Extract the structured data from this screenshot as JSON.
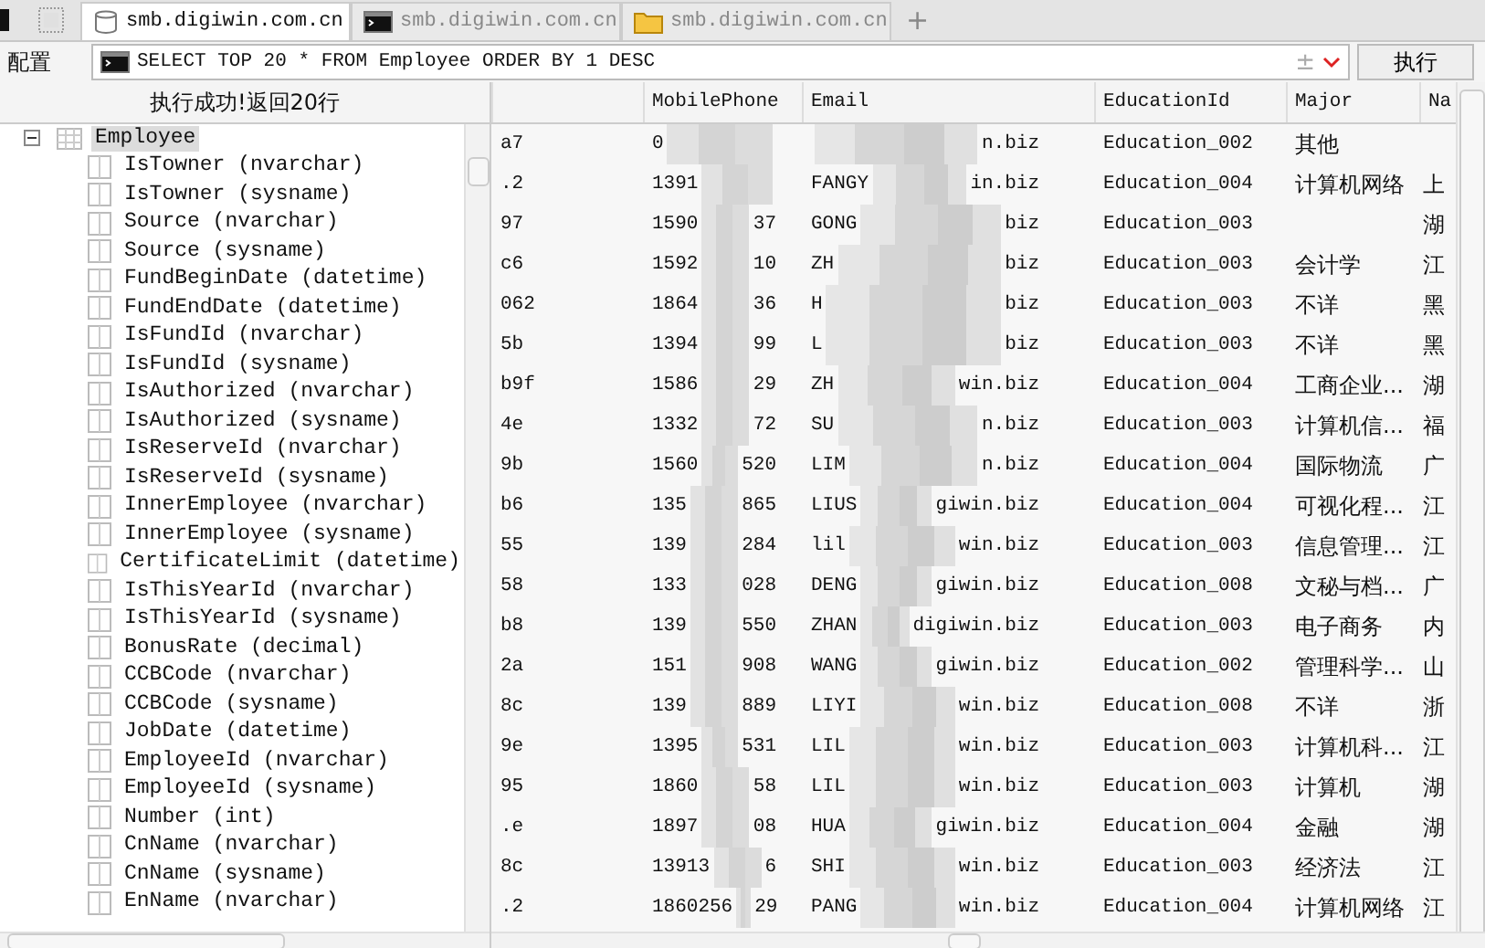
{
  "tabs": [
    {
      "label": "smb.digiwin.com.cn",
      "kind": "database",
      "selected": true
    },
    {
      "label": "smb.digiwin.com.cn",
      "kind": "console",
      "selected": false
    },
    {
      "label": "smb.digiwin.com.cn",
      "kind": "folder",
      "selected": false
    }
  ],
  "new_tab": "+",
  "toolbar": {
    "label": "配置",
    "query": "SELECT TOP 20 * FROM Employee ORDER BY 1 DESC",
    "plus_minus": "±",
    "run_button": "执行"
  },
  "status": "执行成功!返回20行",
  "tree": {
    "label": "Employee",
    "expanded": true,
    "selected": true,
    "children": [
      {
        "label": "IsTowner (nvarchar)"
      },
      {
        "label": "IsTowner (sysname)"
      },
      {
        "label": "Source (nvarchar)"
      },
      {
        "label": "Source (sysname)"
      },
      {
        "label": "FundBeginDate (datetime)"
      },
      {
        "label": "FundEndDate (datetime)"
      },
      {
        "label": "IsFundId (nvarchar)"
      },
      {
        "label": "IsFundId (sysname)"
      },
      {
        "label": "IsAuthorized (nvarchar)"
      },
      {
        "label": "IsAuthorized (sysname)"
      },
      {
        "label": "IsReserveId (nvarchar)"
      },
      {
        "label": "IsReserveId (sysname)"
      },
      {
        "label": "InnerEmployee (nvarchar)"
      },
      {
        "label": "InnerEmployee (sysname)"
      },
      {
        "label": "CertificateLimit (datetime)"
      },
      {
        "label": "IsThisYearId (nvarchar)"
      },
      {
        "label": "IsThisYearId (sysname)"
      },
      {
        "label": "BonusRate (decimal)"
      },
      {
        "label": "CCBCode (nvarchar)"
      },
      {
        "label": "CCBCode (sysname)"
      },
      {
        "label": "JobDate (datetime)"
      },
      {
        "label": "EmployeeId (nvarchar)"
      },
      {
        "label": "EmployeeId (sysname)"
      },
      {
        "label": "Number (int)"
      },
      {
        "label": "CnName (nvarchar)"
      },
      {
        "label": "CnName (sysname)"
      },
      {
        "label": "EnName (nvarchar)"
      }
    ]
  },
  "table": {
    "columns": [
      "MobilePhone",
      "Email",
      "EducationId",
      "Major",
      "Na"
    ],
    "rows": [
      {
        "column_1": "a7",
        "phone_start": "0",
        "phone_end": "",
        "email_start": "",
        "email_end": "n.biz",
        "education": "Education_002",
        "major": "其他",
        "column_6": ""
      },
      {
        "column_1": ".2",
        "phone_start": "1391",
        "phone_end": "",
        "email_start": "FANGY",
        "email_end": "in.biz",
        "education": "Education_004",
        "major": "计算机网络",
        "column_6": "上"
      },
      {
        "column_1": "97",
        "phone_start": "1590",
        "phone_end": "37",
        "email_start": "GONG",
        "email_end": "biz",
        "education": "Education_003",
        "major": "",
        "column_6": "湖"
      },
      {
        "column_1": "c6",
        "phone_start": "1592",
        "phone_end": "10",
        "email_start": "ZH",
        "email_end": "biz",
        "education": "Education_003",
        "major": "会计学",
        "column_6": "江"
      },
      {
        "column_1": "062",
        "phone_start": "1864",
        "phone_end": "36",
        "email_start": "H",
        "email_end": "biz",
        "education": "Education_003",
        "major": "不详",
        "column_6": "黑"
      },
      {
        "column_1": "5b",
        "phone_start": "1394",
        "phone_end": "99",
        "email_start": "L",
        "email_end": "biz",
        "education": "Education_003",
        "major": "不详",
        "column_6": "黑"
      },
      {
        "column_1": "b9f",
        "phone_start": "1586",
        "phone_end": "29",
        "email_start": "ZH",
        "email_end": "win.biz",
        "education": "Education_004",
        "major": "工商企业...",
        "column_6": "湖"
      },
      {
        "column_1": "4e",
        "phone_start": "1332",
        "phone_end": "72",
        "email_start": "SU",
        "email_end": "n.biz",
        "education": "Education_003",
        "major": "计算机信...",
        "column_6": "福"
      },
      {
        "column_1": "9b",
        "phone_start": "1560",
        "phone_end": "520",
        "email_start": "LIM",
        "email_end": "n.biz",
        "education": "Education_004",
        "major": "国际物流",
        "column_6": "广"
      },
      {
        "column_1": "b6",
        "phone_start": "135",
        "phone_end": "865",
        "email_start": "LIUS",
        "email_end": "giwin.biz",
        "education": "Education_004",
        "major": "可视化程...",
        "column_6": "江"
      },
      {
        "column_1": "55",
        "phone_start": "139",
        "phone_end": "284",
        "email_start": "lil",
        "email_end": "win.biz",
        "education": "Education_003",
        "major": "信息管理...",
        "column_6": "江"
      },
      {
        "column_1": "58",
        "phone_start": "133",
        "phone_end": "028",
        "email_start": "DENG",
        "email_end": "giwin.biz",
        "education": "Education_008",
        "major": "文秘与档...",
        "column_6": "广"
      },
      {
        "column_1": "b8",
        "phone_start": "139",
        "phone_end": "550",
        "email_start": "ZHAN",
        "email_end": "digiwin.biz",
        "education": "Education_003",
        "major": "电子商务",
        "column_6": "内"
      },
      {
        "column_1": "2a",
        "phone_start": "151",
        "phone_end": "908",
        "email_start": "WANG",
        "email_end": "giwin.biz",
        "education": "Education_002",
        "major": "管理科学...",
        "column_6": "山"
      },
      {
        "column_1": "8c",
        "phone_start": "139",
        "phone_end": "889",
        "email_start": "LIYI",
        "email_end": "win.biz",
        "education": "Education_008",
        "major": "不详",
        "column_6": "浙"
      },
      {
        "column_1": "9e",
        "phone_start": "1395",
        "phone_end": "531",
        "email_start": "LIL",
        "email_end": "win.biz",
        "education": "Education_003",
        "major": "计算机科...",
        "column_6": "江"
      },
      {
        "column_1": "95",
        "phone_start": "1860",
        "phone_end": "58",
        "email_start": "LIL",
        "email_end": "win.biz",
        "education": "Education_003",
        "major": "计算机",
        "column_6": "湖"
      },
      {
        "column_1": ".e",
        "phone_start": "1897",
        "phone_end": "08",
        "email_start": "HUA",
        "email_end": "giwin.biz",
        "education": "Education_004",
        "major": "金融",
        "column_6": "湖"
      },
      {
        "column_1": "8c",
        "phone_start": "13913",
        "phone_end": "6",
        "email_start": "SHI",
        "email_end": "win.biz",
        "education": "Education_003",
        "major": "经济法",
        "column_6": "江"
      },
      {
        "column_1": ".2",
        "phone_start": "1860256",
        "phone_end": "29",
        "email_start": "PANG",
        "email_end": "win.biz",
        "education": "Education_004",
        "major": "计算机网络",
        "column_6": "江"
      }
    ]
  }
}
